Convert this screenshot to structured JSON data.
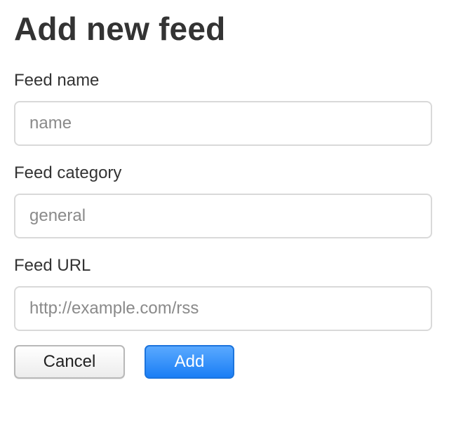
{
  "page": {
    "title": "Add new feed"
  },
  "form": {
    "name": {
      "label": "Feed name",
      "value": "",
      "placeholder": "name"
    },
    "category": {
      "label": "Feed category",
      "value": "",
      "placeholder": "general"
    },
    "url": {
      "label": "Feed URL",
      "value": "",
      "placeholder": "http://example.com/rss"
    }
  },
  "actions": {
    "cancel_label": "Cancel",
    "add_label": "Add"
  },
  "colors": {
    "primary_button": "#2e8df8",
    "input_border": "#d9d9d9",
    "text": "#333333"
  }
}
